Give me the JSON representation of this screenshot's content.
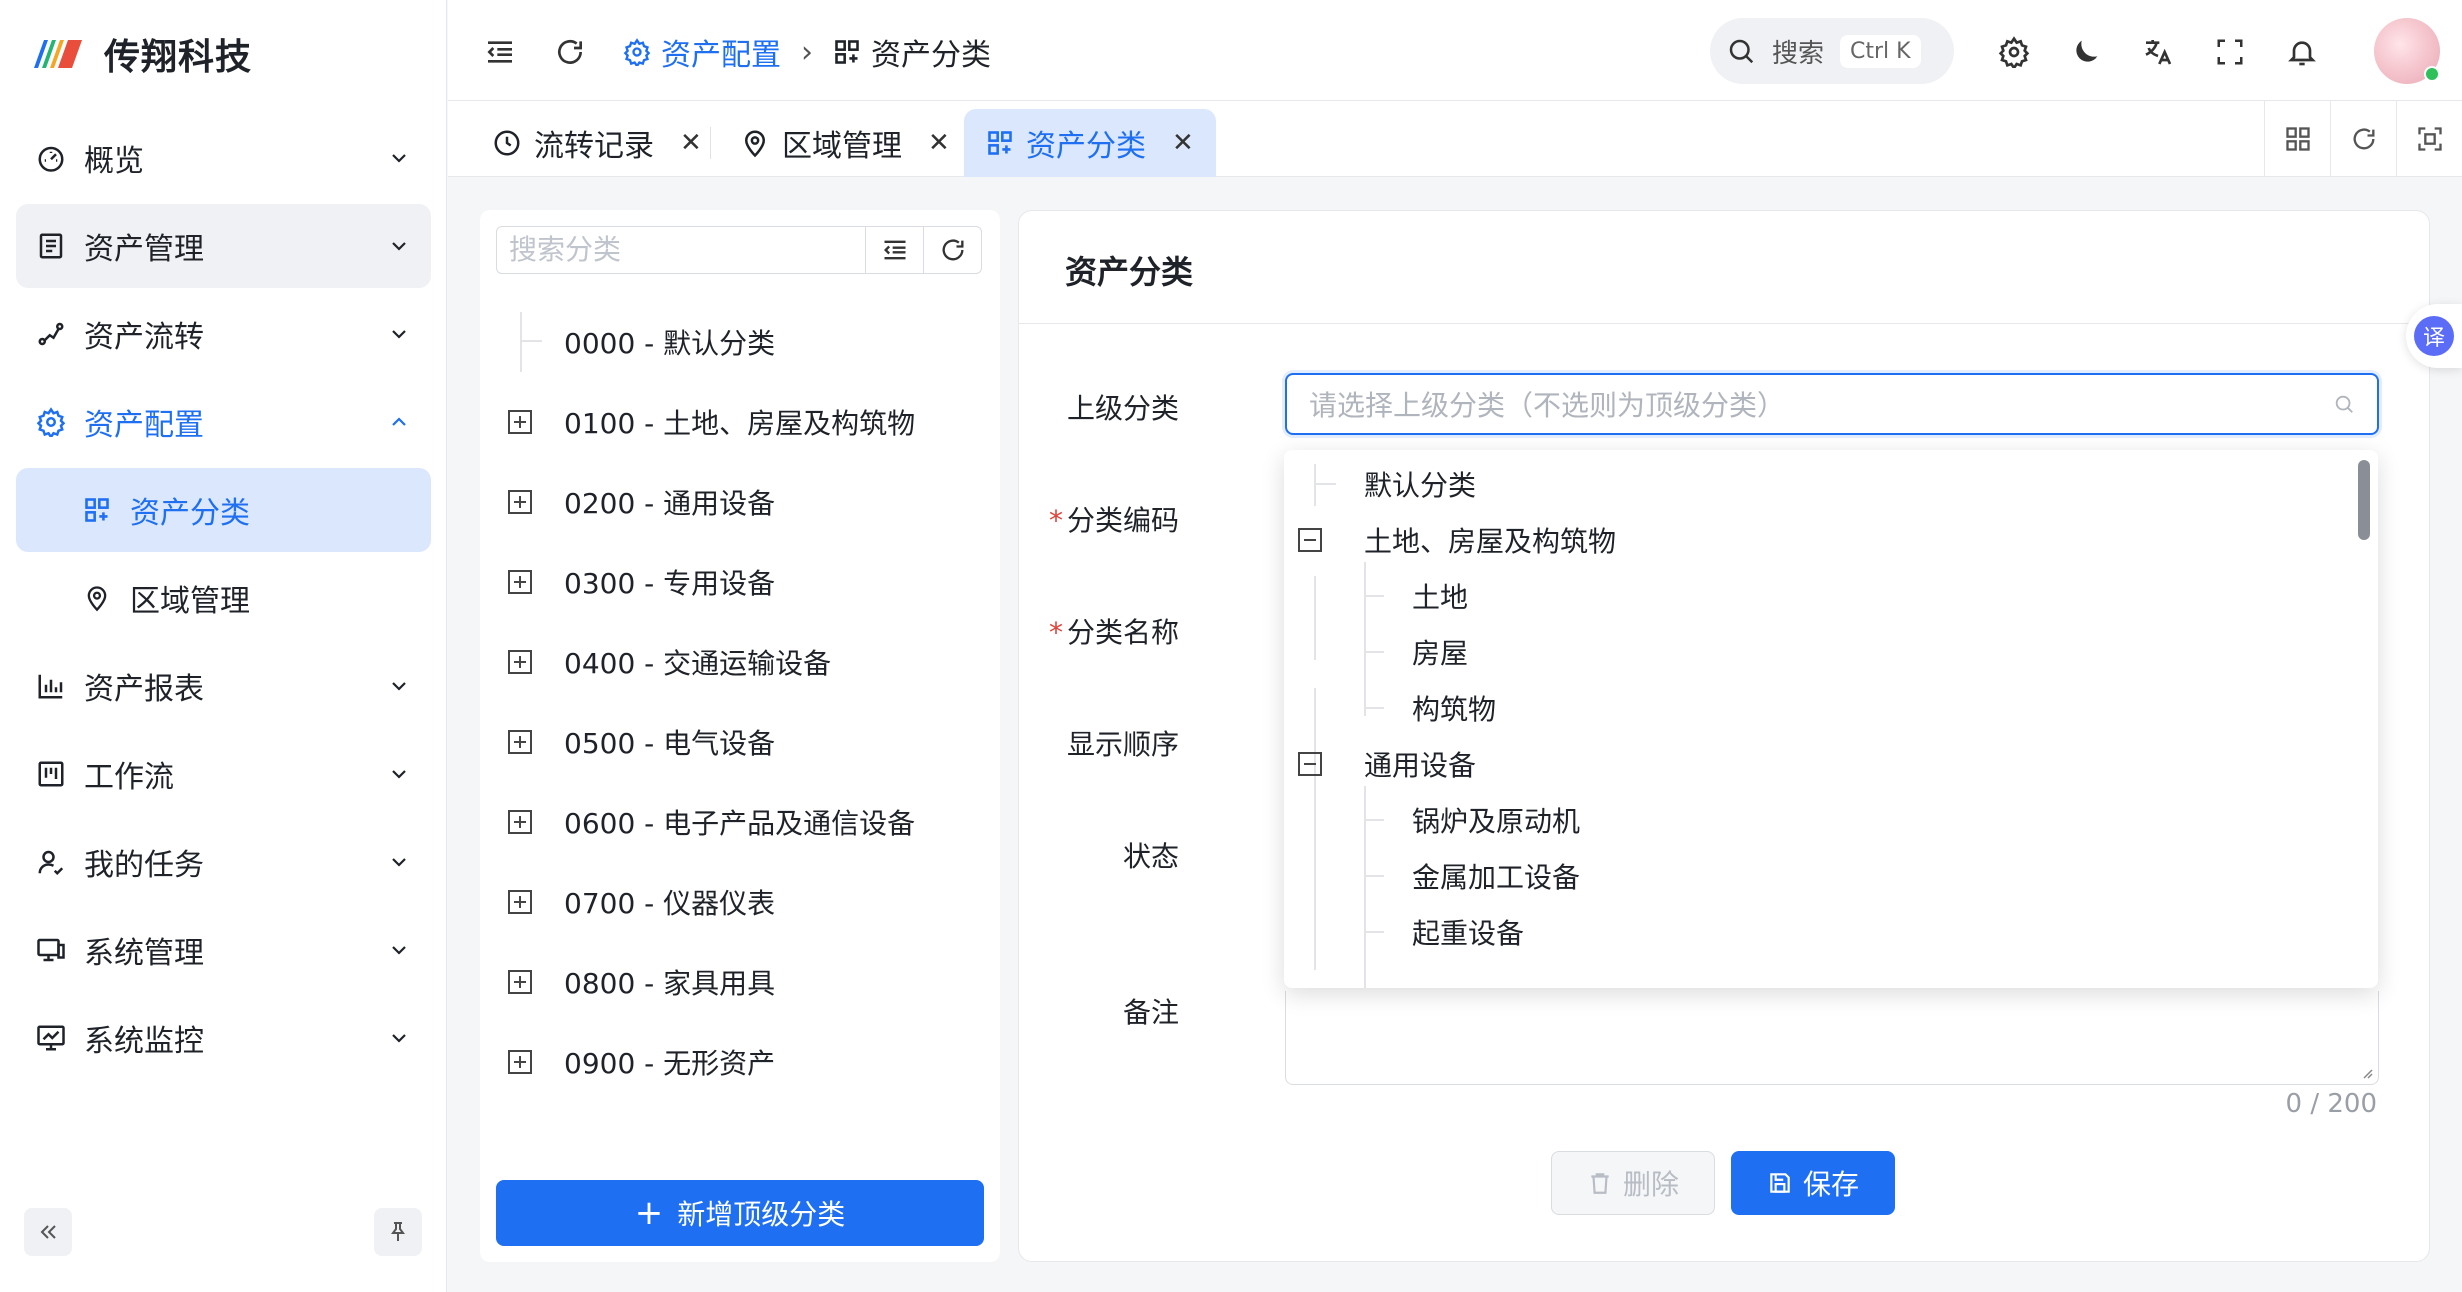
{
  "app": {
    "title": "传翔科技"
  },
  "sidebar": {
    "items": [
      {
        "label": "概览",
        "icon": "gauge-icon"
      },
      {
        "label": "资产管理",
        "icon": "clipboard-icon"
      },
      {
        "label": "资产流转",
        "icon": "flow-icon"
      },
      {
        "label": "资产配置",
        "icon": "gear-icon"
      },
      {
        "label": "资产分类",
        "icon": "category-icon"
      },
      {
        "label": "区域管理",
        "icon": "location-icon"
      },
      {
        "label": "资产报表",
        "icon": "bar-chart-icon"
      },
      {
        "label": "工作流",
        "icon": "kanban-icon"
      },
      {
        "label": "我的任务",
        "icon": "user-task-icon"
      },
      {
        "label": "系统管理",
        "icon": "monitor-icon"
      },
      {
        "label": "系统监控",
        "icon": "monitor-chart-icon"
      }
    ]
  },
  "header": {
    "breadcrumb": [
      "资产配置",
      "资产分类"
    ],
    "search_label": "搜索",
    "search_shortcut": "Ctrl K"
  },
  "tabs": [
    {
      "label": "流转记录"
    },
    {
      "label": "区域管理"
    },
    {
      "label": "资产分类"
    }
  ],
  "tree": {
    "search_placeholder": "搜索分类",
    "items": [
      "0000 - 默认分类",
      "0100 - 土地、房屋及构筑物",
      "0200 - 通用设备",
      "0300 - 专用设备",
      "0400 - 交通运输设备",
      "0500 - 电气设备",
      "0600 - 电子产品及通信设备",
      "0700 - 仪器仪表",
      "0800 - 家具用具",
      "0900 - 无形资产"
    ],
    "add_button": "新增顶级分类"
  },
  "form": {
    "title": "资产分类",
    "labels": {
      "parent": "上级分类",
      "code": "分类编码",
      "name": "分类名称",
      "order": "显示顺序",
      "status": "状态",
      "remark": "备注"
    },
    "required_mark": "*",
    "parent_placeholder": "请选择上级分类（不选则为顶级分类）",
    "remark_count": "0 / 200",
    "delete_button": "删除",
    "save_button": "保存"
  },
  "dropdown": {
    "items": [
      {
        "label": "默认分类",
        "level": 1
      },
      {
        "label": "土地、房屋及构筑物",
        "level": 1
      },
      {
        "label": "土地",
        "level": 2
      },
      {
        "label": "房屋",
        "level": 2
      },
      {
        "label": "构筑物",
        "level": 2
      },
      {
        "label": "通用设备",
        "level": 1
      },
      {
        "label": "锅炉及原动机",
        "level": 2
      },
      {
        "label": "金属加工设备",
        "level": 2
      },
      {
        "label": "起重设备",
        "level": 2
      }
    ]
  },
  "translate_badge": "译",
  "colors": {
    "primary": "#1e6ff1",
    "active_bg": "#dbe7fd",
    "danger": "#e0413a"
  }
}
